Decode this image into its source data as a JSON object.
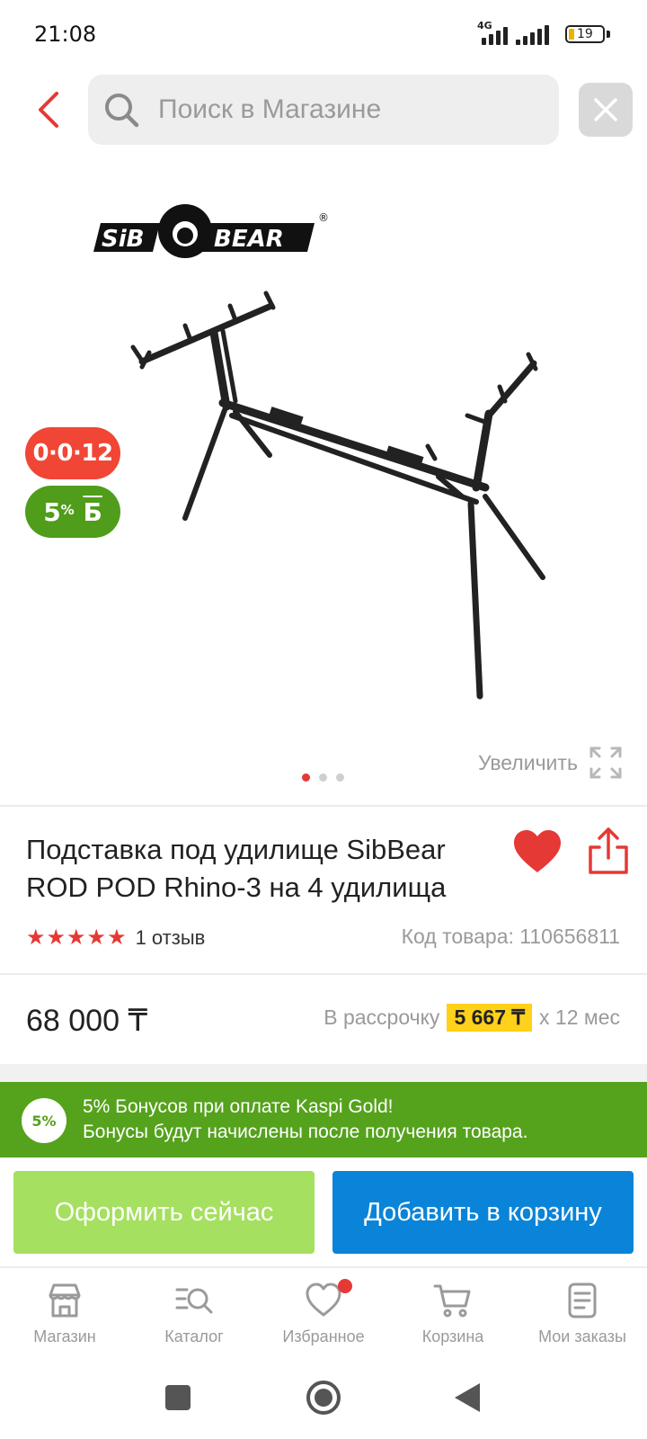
{
  "status_bar": {
    "time": "21:08",
    "network": "4G",
    "battery": "19"
  },
  "header": {
    "search_placeholder": "Поиск в Магазине"
  },
  "product": {
    "brand": "SibBear",
    "badges": {
      "installment": "0·0·12",
      "bonus_value": "5",
      "bonus_unit": "%",
      "bonus_currency": "Б"
    },
    "zoom_label": "Увеличить",
    "gallery_dots": 3,
    "gallery_active": 0,
    "title": "Подставка под удилище SibBear ROD POD Rhino-3 на 4 удилища",
    "rating_stars": 5,
    "reviews": "1 отзыв",
    "code": "Код товара: 110656811",
    "price": "68 000 ₸",
    "installment_prefix": "В рассрочку",
    "installment_amount": "5 667 ₸",
    "installment_suffix": "x 12 мес"
  },
  "bonus_banner": {
    "badge": "5%",
    "line1": "5% Бонусов при оплате Kaspi Gold!",
    "line2": "Бонусы будут начислены после получения товара."
  },
  "actions": {
    "checkout": "Оформить сейчас",
    "add_to_cart": "Добавить в корзину"
  },
  "bottom_nav": [
    {
      "label": "Магазин",
      "icon": "shop-icon"
    },
    {
      "label": "Каталог",
      "icon": "catalog-search-icon"
    },
    {
      "label": "Избранное",
      "icon": "heart-outline-icon"
    },
    {
      "label": "Корзина",
      "icon": "cart-icon"
    },
    {
      "label": "Мои заказы",
      "icon": "orders-icon"
    }
  ],
  "colors": {
    "accent_red": "#e53935",
    "bonus_green": "#55a21c",
    "cart_blue": "#0a84d8",
    "checkout_green": "#a5e060",
    "installment_yellow": "#ffd11a"
  }
}
